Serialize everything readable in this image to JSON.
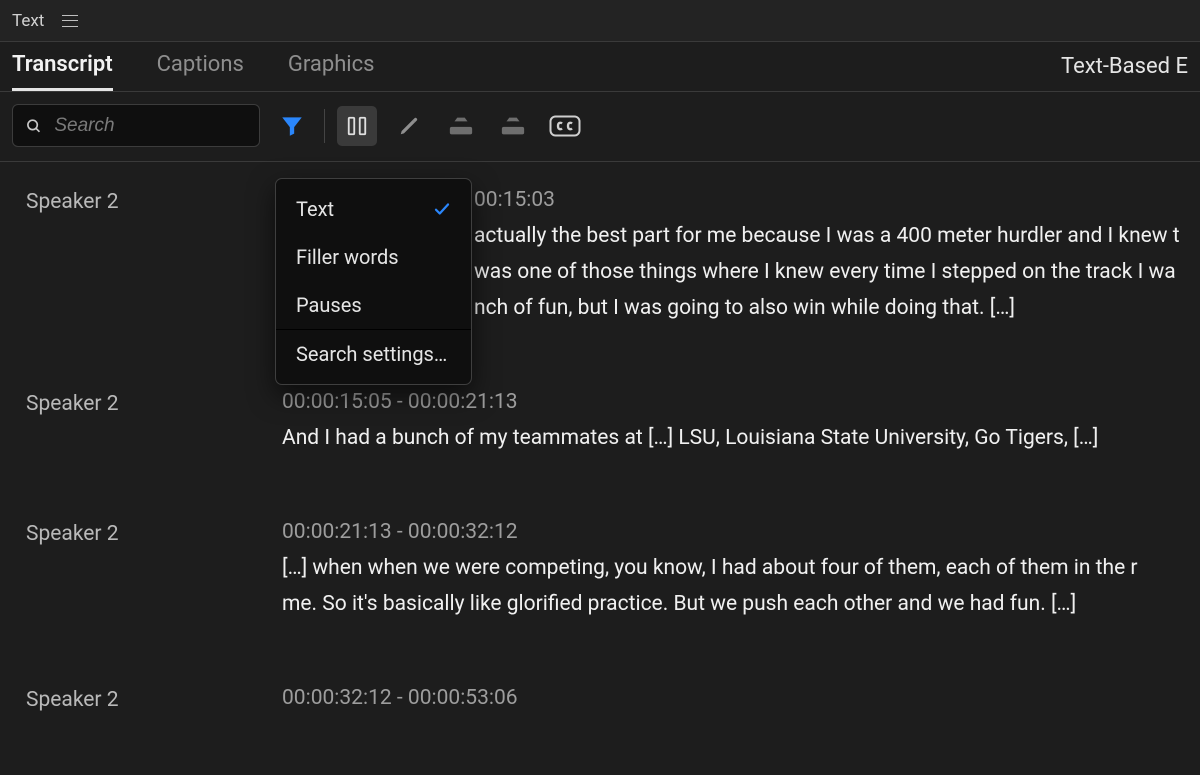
{
  "header": {
    "panel_title": "Text"
  },
  "subnav": {
    "tabs": [
      "Transcript",
      "Captions",
      "Graphics"
    ],
    "active_index": 0,
    "right_label": "Text-Based E"
  },
  "search": {
    "placeholder": "Search",
    "value": ""
  },
  "toolbar_icons": {
    "filter": "funnel-icon",
    "sliders": "sliders-icon",
    "pencil": "pencil-icon",
    "export1": "export-down-icon",
    "export2": "export-up-icon",
    "cc": "closed-caption-icon"
  },
  "dropdown": {
    "items": [
      {
        "label": "Text",
        "checked": true
      },
      {
        "label": "Filler words",
        "checked": false
      },
      {
        "label": "Pauses",
        "checked": false
      },
      {
        "label": "Search settings…",
        "checked": false,
        "sep": true
      }
    ]
  },
  "transcript": [
    {
      "speaker": "Speaker 2",
      "time": "00:15:03",
      "text_lines": [
        "actually the best part for me because I was a 400 meter hurdler and I knew t",
        "was one of those things where I knew every time I stepped on the track I wa",
        "nch of fun, but I was going to also win while doing that. […]"
      ]
    },
    {
      "speaker": "Speaker 2",
      "time": "00:00:15:05 - 00:00:21:13",
      "text_lines": [
        "And I had a bunch of my teammates at […] LSU, Louisiana State University, Go Tigers, […]"
      ]
    },
    {
      "speaker": "Speaker 2",
      "time": "00:00:21:13 - 00:00:32:12",
      "text_lines": [
        "[…] when when we were competing, you know, I had about four of them, each of them in the r",
        "me. So it's basically like glorified practice. But we push each other and we had fun. […]"
      ]
    },
    {
      "speaker": "Speaker 2",
      "time": "00:00:32:12 - 00:00:53:06",
      "text_lines": []
    }
  ]
}
